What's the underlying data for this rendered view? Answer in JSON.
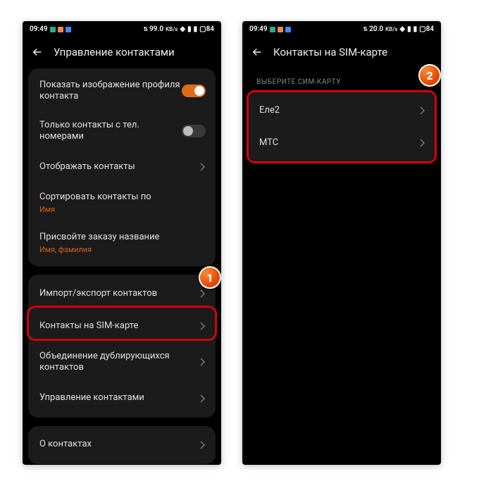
{
  "status": {
    "time": "09:49",
    "net": "99.0",
    "netUnit": "KB/s",
    "net2": "20.0",
    "net2Unit": "KB/s",
    "battery": "84"
  },
  "left": {
    "title": "Управление контактами",
    "showProfileImage": "Показать изображение профиля контакта",
    "onlyWithNumbers": "Только контакты с тел. номерами",
    "displayContacts": "Отображать контакты",
    "sortBy": "Сортировать контакты по",
    "sortByValue": "Имя",
    "customOrder": "Присвойте заказу название",
    "customOrderValue": "Имя, фамилия",
    "importExport": "Импорт/экспорт контактов",
    "simContacts": "Контакты на SIM-карте",
    "mergeDup": "Объединение дублирующихся контактов",
    "manage": "Управление контактами",
    "about": "О контактах"
  },
  "right": {
    "title": "Контакты на SIM-карте",
    "selectSim": "ВЫБЕРИТЕ СИМ-КАРТУ",
    "sim1": "Еле2",
    "sim2": "МТС"
  },
  "badge1": "1",
  "badge2": "2"
}
